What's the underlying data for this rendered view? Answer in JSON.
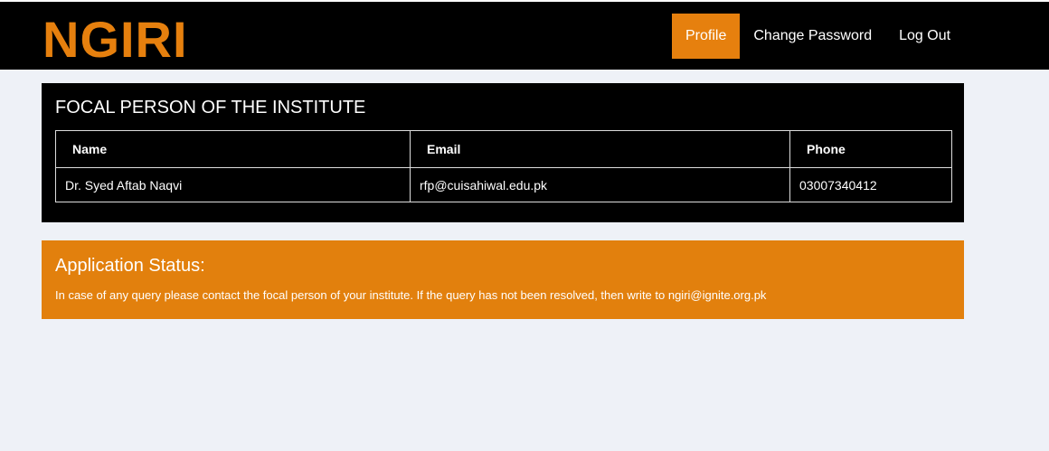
{
  "header": {
    "brand": "NGIRI",
    "nav": [
      {
        "label": "Profile",
        "active": true
      },
      {
        "label": "Change Password",
        "active": false
      },
      {
        "label": "Log Out",
        "active": false
      }
    ]
  },
  "focal_panel": {
    "title": "FOCAL PERSON OF THE INSTITUTE",
    "columns": [
      "Name",
      "Email",
      "Phone"
    ],
    "rows": [
      [
        "Dr. Syed Aftab Naqvi",
        "rfp@cuisahiwal.edu.pk",
        "03007340412"
      ]
    ]
  },
  "status_panel": {
    "title": "Application Status:",
    "message": "In case of any query please contact the focal person of your institute. If the query has not been resolved, then write to ngiri@ignite.org.pk"
  },
  "colors": {
    "accent": "#e6800e",
    "header_bg": "#000000",
    "page_bg": "#eef1f7"
  }
}
